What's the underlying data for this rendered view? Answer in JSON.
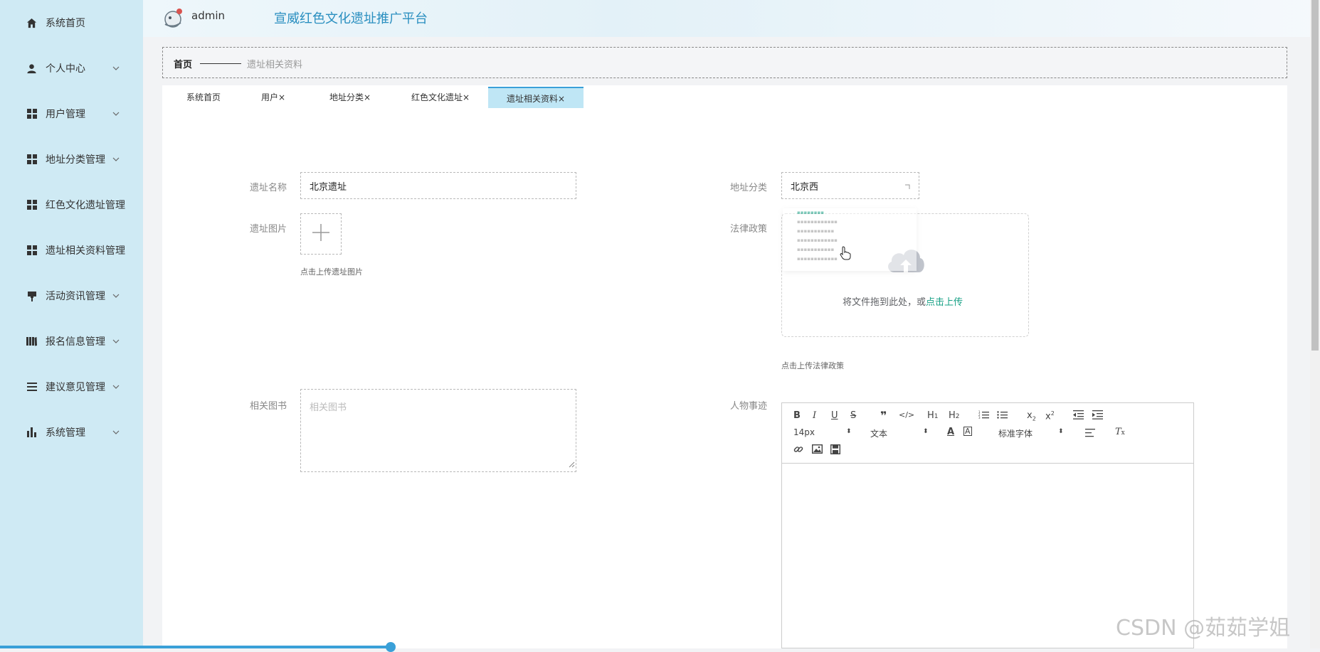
{
  "header": {
    "admin_name": "admin",
    "site_title": "宣威红色文化遗址推广平台"
  },
  "sidebar": {
    "items": [
      {
        "label": "系统首页",
        "icon": "home-icon",
        "has_children": false
      },
      {
        "label": "个人中心",
        "icon": "user-icon",
        "has_children": true
      },
      {
        "label": "用户管理",
        "icon": "grid-icon",
        "has_children": true
      },
      {
        "label": "地址分类管理",
        "icon": "grid-icon",
        "has_children": true
      },
      {
        "label": "红色文化遗址管理",
        "icon": "grid-icon",
        "has_children": false
      },
      {
        "label": "遗址相关资料管理",
        "icon": "grid-icon",
        "has_children": false
      },
      {
        "label": "活动资讯管理",
        "icon": "pin-icon",
        "has_children": true
      },
      {
        "label": "报名信息管理",
        "icon": "book-icon",
        "has_children": true
      },
      {
        "label": "建议意见管理",
        "icon": "list-icon",
        "has_children": true
      },
      {
        "label": "系统管理",
        "icon": "bar-chart-icon",
        "has_children": true
      }
    ]
  },
  "breadcrumb": {
    "home": "首页",
    "current": "遗址相关资料"
  },
  "tabs": [
    {
      "label": "系统首页",
      "closable": false
    },
    {
      "label": "用户",
      "closable": true
    },
    {
      "label": "地址分类",
      "closable": true
    },
    {
      "label": "红色文化遗址",
      "closable": true
    },
    {
      "label": "遗址相关资料",
      "closable": true,
      "active": true
    }
  ],
  "tab_close": "×",
  "form": {
    "site_name_label": "遗址名称",
    "site_name_value": "北京遗址",
    "category_label": "地址分类",
    "category_value": "北京西",
    "site_image_label": "遗址图片",
    "site_image_hint": "点击上传遗址图片",
    "policy_label": "法律政策",
    "policy_drag_text": "将文件拖到此处，或",
    "policy_drag_link": "点击上传",
    "policy_hint": "点击上传法律政策",
    "books_label": "相关图书",
    "books_placeholder": "相关图书",
    "people_label": "人物事迹"
  },
  "editor": {
    "font_size": "14px",
    "block_format": "文本",
    "font_family": "标准字体"
  },
  "watermark": "CSDN @茹茹学姐",
  "colors": {
    "sidebar_bg": "#cfeaf4",
    "accent": "#3aa0d8",
    "link": "#16a085",
    "title": "#2a8fc0"
  }
}
